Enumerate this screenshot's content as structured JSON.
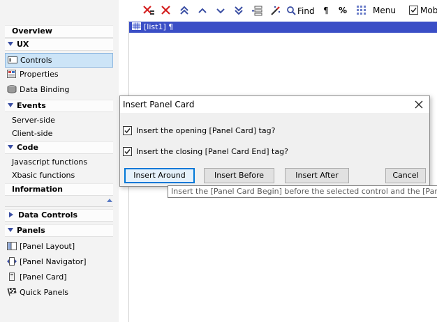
{
  "toolbar": {
    "find_label": "Find",
    "pilcrow_label": "¶",
    "percent_label": "%",
    "menu_label": "Menu",
    "mobile_label": "Mobi"
  },
  "sidebar": {
    "overview": "Overview",
    "ux": "UX",
    "controls": "Controls",
    "properties": "Properties",
    "data_binding": "Data Binding",
    "events": "Events",
    "server_side": "Server-side",
    "client_side": "Client-side",
    "code": "Code",
    "javascript_functions": "Javascript functions",
    "xbasic_functions": "Xbasic functions",
    "information": "Information",
    "data_controls": "Data Controls",
    "panels": "Panels",
    "panel_layout": "[Panel Layout]",
    "panel_navigator": "[Panel Navigator]",
    "panel_card": "[Panel Card]",
    "quick_panels": "Quick Panels"
  },
  "editor": {
    "line1": "[list1] ¶"
  },
  "dialog": {
    "title": "Insert Panel Card",
    "opt_opening": "Insert the opening [Panel Card] tag?",
    "opt_closing": "Insert the closing [Panel Card End] tag?",
    "opt_opening_checked": true,
    "opt_closing_checked": true,
    "btn_around": "Insert Around",
    "btn_before": "Insert Before",
    "btn_after": "Insert After",
    "btn_cancel": "Cancel"
  },
  "tooltip": {
    "text": "Insert the [Panel Card Begin] before the selected control and the [Panel Card End] after the selected control"
  },
  "colors": {
    "accent_blue": "#3a4ec6",
    "delete_red": "#d42020",
    "selection": "#cce4f7"
  }
}
